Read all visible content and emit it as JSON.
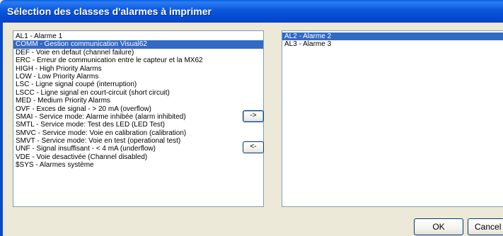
{
  "window": {
    "title": "Sélection des classes d'alarmes à imprimer"
  },
  "available_list": {
    "items": [
      {
        "label": "AL1  - Alarme 1",
        "selected": false
      },
      {
        "label": "COMM - Gestion communication Visual62",
        "selected": true
      },
      {
        "label": "DEF  - Voie en defaut (channel failure)",
        "selected": false
      },
      {
        "label": "ERC  - Erreur de communication entre le capteur et la MX62",
        "selected": false
      },
      {
        "label": "HIGH - High Priority Alarms",
        "selected": false
      },
      {
        "label": "LOW  - Low Priority Alarms",
        "selected": false
      },
      {
        "label": "LSC  - Ligne signal coupé (interruption)",
        "selected": false
      },
      {
        "label": "LSCC - Ligne signal en court-circuit (short circuit)",
        "selected": false
      },
      {
        "label": "MED  - Medium Priority Alarms",
        "selected": false
      },
      {
        "label": "OVF  - Exces de signal - > 20 mA (overflow)",
        "selected": false
      },
      {
        "label": "SMAI - Service mode: Alarme inhibée (alarm inhibited)",
        "selected": false
      },
      {
        "label": "SMTL - Service mode: Test des LED (LED Test)",
        "selected": false
      },
      {
        "label": "SMVC - Service mode: Voie en calibration (calibration)",
        "selected": false
      },
      {
        "label": "SMVT - Service mode: Voie en test (operational test)",
        "selected": false
      },
      {
        "label": "UNF  - Signal insuffisant - < 4 mA (underflow)",
        "selected": false
      },
      {
        "label": "VDE  - Voie desactivée (Channel disabled)",
        "selected": false
      },
      {
        "label": "$SYS - Alarmes système",
        "selected": false
      }
    ]
  },
  "selected_list": {
    "items": [
      {
        "label": "AL2  - Alarme 2",
        "selected": true
      },
      {
        "label": "AL3  - Alarme 3",
        "selected": false
      }
    ]
  },
  "buttons": {
    "move_right": "->",
    "move_left": "<-",
    "ok": "OK",
    "cancel": "Cancel"
  },
  "colors": {
    "title_bar": "#0449d1",
    "selection": "#316ac5",
    "dialog_face": "#ece9d8"
  }
}
